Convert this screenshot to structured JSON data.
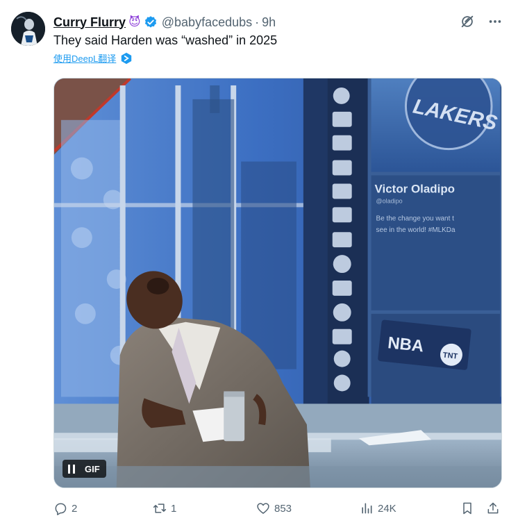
{
  "tweet": {
    "author": {
      "display_name": "Curry Flurry",
      "name_emoji": "😈",
      "verified": true,
      "handle": "@babyfacedubs",
      "separator": "·",
      "time_ago": "9h"
    },
    "text": "They said Harden was “washed” in 2025",
    "translate_link": "使用DeepL翻译",
    "media": {
      "type": "gif",
      "gif_label": "GIF",
      "scene_text": {
        "player_name": "Victor Oladipo",
        "player_handle": "@oladipo",
        "player_quote_line1": "Be the change you want t",
        "player_quote_line2": "see in the world! #MLKDa",
        "network_logo_nba": "NBA",
        "network_logo_tnt": "TNT",
        "team_banner": "LAKERS"
      }
    },
    "actions": {
      "replies": "2",
      "retweets": "1",
      "likes": "853",
      "views": "24K"
    }
  },
  "colors": {
    "accent": "#1d9bf0",
    "text_primary": "#0f1419",
    "text_secondary": "#536471",
    "verified_badge": "#1d9bf0"
  }
}
